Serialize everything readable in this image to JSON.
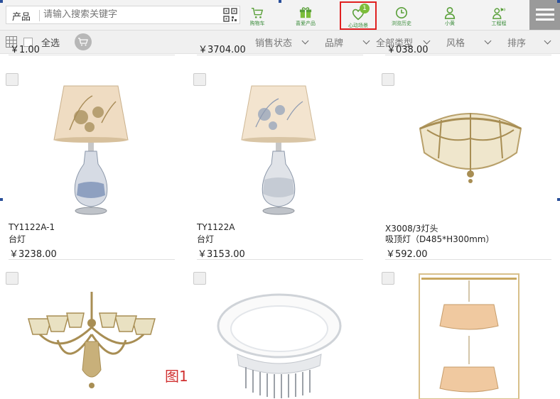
{
  "search": {
    "category": "产品",
    "placeholder": "请输入搜索关键字"
  },
  "nav": [
    {
      "label": "购物车",
      "icon": "cart-icon"
    },
    {
      "label": "喜爱产品",
      "icon": "gift-icon"
    },
    {
      "label": "心动场景",
      "icon": "heart-icon",
      "badge": "1",
      "active": true
    },
    {
      "label": "浏览历史",
      "icon": "clock-icon"
    },
    {
      "label": "小黄",
      "icon": "user-icon"
    },
    {
      "label": "工程程",
      "icon": "user-speaker-icon"
    }
  ],
  "toolbar": {
    "select_all": "全选",
    "filters": [
      "销售状态",
      "品牌",
      "全部类型",
      "风格",
      "排序"
    ]
  },
  "cut_prices": [
    "￥1.00",
    "￥3704.00",
    "￥038.00"
  ],
  "products": [
    {
      "code": "TY1122A-1",
      "name": "台灯",
      "price": "￥3238.00"
    },
    {
      "code": "TY1122A",
      "name": "台灯",
      "price": "￥3153.00"
    },
    {
      "code": "X3008/3灯头",
      "name": "吸顶灯（D485*H300mm）",
      "price": "￥592.00"
    }
  ],
  "figure_label": "图1",
  "colors": {
    "accent": "#7cbd3a",
    "nav_label": "#3a8c3a",
    "active_border": "#e02020"
  }
}
